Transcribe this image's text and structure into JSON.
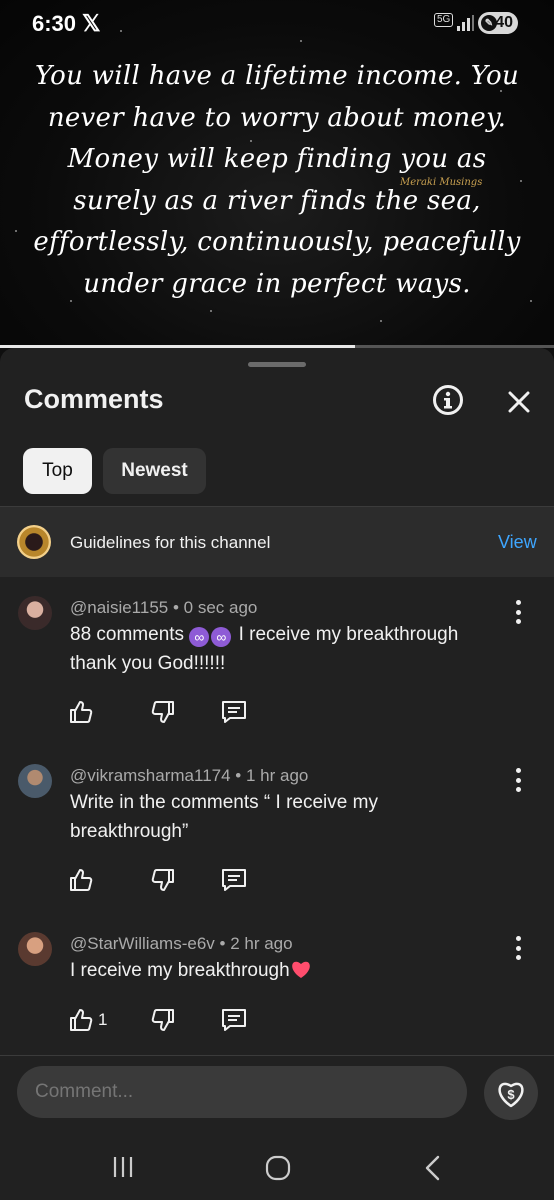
{
  "status_bar": {
    "time": "6:30",
    "network": "5G",
    "battery": "40"
  },
  "video": {
    "quote_lines": [
      "You will have a lifetime income. You",
      "never have to worry about money.",
      "Money will keep finding you as",
      "surely as a river finds the sea,",
      "effortlessly, continuously, peacefully",
      "under grace in perfect ways."
    ],
    "watermark": "Meraki Musings",
    "progress": 0.64
  },
  "comments_panel": {
    "title": "Comments",
    "sort_chips": {
      "top": "Top",
      "newest": "Newest"
    },
    "guidelines": {
      "text": "Guidelines for this channel",
      "link": "View"
    },
    "comments": [
      {
        "author": "@naisie1155",
        "time": "0 sec ago",
        "text_before": "88 comments",
        "text_after": "I receive my breakthrough thank you God!!!!!!",
        "likes": ""
      },
      {
        "author": "@vikramsharma1174",
        "time": "1 hr ago",
        "text": "Write in the comments “ I receive my breakthrough”",
        "likes": ""
      },
      {
        "author": "@StarWilliams-e6v",
        "time": "2 hr ago",
        "text": "I receive my breakthrough",
        "likes": "1"
      }
    ],
    "input_placeholder": "Comment..."
  }
}
